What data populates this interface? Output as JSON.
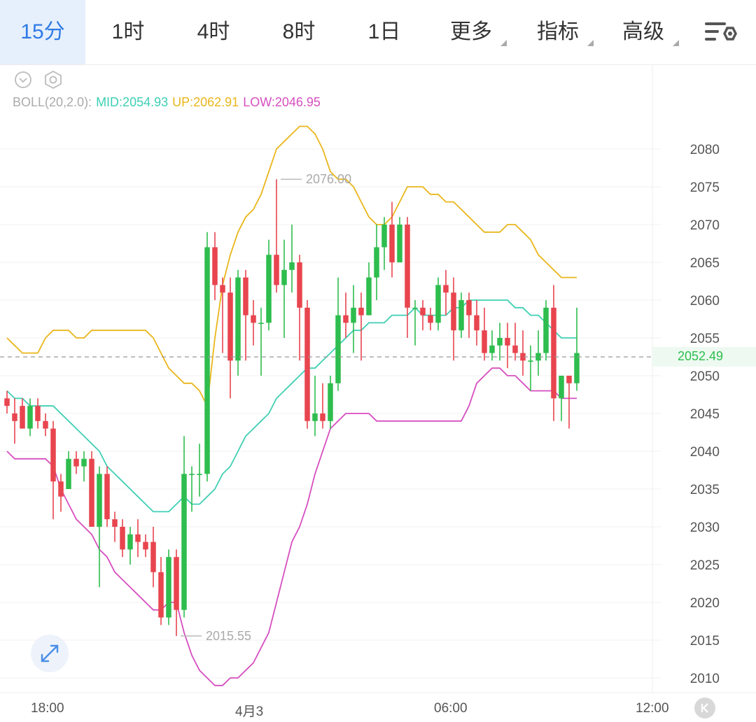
{
  "tabs": [
    {
      "label": "15分",
      "active": true
    },
    {
      "label": "1时"
    },
    {
      "label": "4时"
    },
    {
      "label": "8时"
    },
    {
      "label": "1日"
    },
    {
      "label": "更多",
      "dropdown": true
    },
    {
      "label": "指标",
      "dropdown": true
    },
    {
      "label": "高级",
      "dropdown": true
    }
  ],
  "icons": {
    "settings": "settings-sliders-icon",
    "collapse": "chevron-down-circle-icon",
    "gear": "hexagon-gear-icon",
    "expand": "expand-arrows-icon",
    "back": "skip-to-start-icon"
  },
  "indicator": {
    "name": "BOLL(20,2.0):",
    "mid": "MID:2054.93",
    "up": "UP:2062.91",
    "low": "LOW:2046.95"
  },
  "colors": {
    "up": "#e8454f",
    "down": "#2ebd4e",
    "mid": "#3fcfb4",
    "upper": "#e9b61b",
    "lower": "#d64fc0",
    "last_price": "#2ebd4e"
  },
  "xaxis": {
    "labels": [
      "18:00",
      "4月3",
      "06:00",
      "12:00"
    ]
  },
  "chart_data": {
    "type": "candlestick",
    "interval": "15分",
    "y_ticks": [
      2080,
      2075,
      2070,
      2065,
      2060,
      2055,
      2050,
      2045,
      2040,
      2035,
      2030,
      2025,
      2020,
      2015,
      2010
    ],
    "ylim": [
      2008,
      2084
    ],
    "last_price": 2052.49,
    "last_price_label": "2052.49",
    "high_marker": {
      "value": 2076.0,
      "label": "2076.00"
    },
    "low_marker": {
      "value": 2015.55,
      "label": "2015.55"
    },
    "candles": [
      [
        2047,
        2046,
        2048,
        2045
      ],
      [
        2045,
        2044,
        2047,
        2041
      ],
      [
        2046,
        2043,
        2047,
        2043
      ],
      [
        2043,
        2046,
        2047,
        2042
      ],
      [
        2046,
        2044,
        2047,
        2043
      ],
      [
        2044,
        2043,
        2045,
        2042
      ],
      [
        2043,
        2036,
        2044,
        2031
      ],
      [
        2036,
        2034,
        2037,
        2032
      ],
      [
        2035,
        2039,
        2040,
        2035
      ],
      [
        2039,
        2038,
        2040,
        2037
      ],
      [
        2038,
        2039,
        2040,
        2036
      ],
      [
        2039,
        2030,
        2040,
        2030
      ],
      [
        2030,
        2037,
        2038,
        2022
      ],
      [
        2037,
        2031,
        2038,
        2030
      ],
      [
        2031,
        2030,
        2032,
        2028
      ],
      [
        2030,
        2027,
        2031,
        2026
      ],
      [
        2027,
        2029,
        2030,
        2025
      ],
      [
        2029,
        2028,
        2031,
        2026
      ],
      [
        2028,
        2027,
        2029,
        2026
      ],
      [
        2028,
        2024,
        2030,
        2022
      ],
      [
        2024,
        2018,
        2026,
        2017
      ],
      [
        2018,
        2026,
        2027,
        2017
      ],
      [
        2026,
        2019,
        2027,
        2015.55
      ],
      [
        2019,
        2037,
        2042,
        2018
      ],
      [
        2037,
        2037,
        2038,
        2032
      ],
      [
        2037,
        2037,
        2041,
        2034
      ],
      [
        2037,
        2067,
        2069,
        2036
      ],
      [
        2067,
        2062,
        2069,
        2060
      ],
      [
        2062,
        2061,
        2063,
        2053
      ],
      [
        2061,
        2052,
        2063,
        2047
      ],
      [
        2052,
        2063,
        2064,
        2050
      ],
      [
        2063,
        2058,
        2064,
        2052
      ],
      [
        2058,
        2057,
        2060,
        2054
      ],
      [
        2057,
        2057,
        2059,
        2050
      ],
      [
        2057,
        2066,
        2068,
        2056
      ],
      [
        2066,
        2062,
        2076,
        2061
      ],
      [
        2062,
        2064,
        2068,
        2055
      ],
      [
        2064,
        2065,
        2070,
        2061
      ],
      [
        2065,
        2059,
        2066,
        2052
      ],
      [
        2059,
        2044,
        2060,
        2043
      ],
      [
        2044,
        2045,
        2050,
        2042
      ],
      [
        2045,
        2044,
        2049,
        2043
      ],
      [
        2044,
        2049,
        2050,
        2043
      ],
      [
        2049,
        2058,
        2063,
        2048
      ],
      [
        2058,
        2057,
        2061,
        2055
      ],
      [
        2057,
        2059,
        2062,
        2053
      ],
      [
        2059,
        2058,
        2061,
        2052
      ],
      [
        2058,
        2063,
        2065,
        2058
      ],
      [
        2063,
        2067,
        2070,
        2060
      ],
      [
        2067,
        2070,
        2071,
        2064
      ],
      [
        2070,
        2065,
        2073,
        2063
      ],
      [
        2065,
        2070,
        2071,
        2065
      ],
      [
        2070,
        2059,
        2071,
        2055
      ],
      [
        2059,
        2059,
        2060,
        2054
      ],
      [
        2059,
        2058,
        2060,
        2056
      ],
      [
        2058,
        2057,
        2059,
        2056
      ],
      [
        2057,
        2062,
        2063,
        2056
      ],
      [
        2062,
        2061,
        2064,
        2058
      ],
      [
        2061,
        2056,
        2063,
        2052
      ],
      [
        2056,
        2060,
        2061,
        2055
      ],
      [
        2060,
        2058,
        2061,
        2055
      ],
      [
        2058,
        2056,
        2060,
        2054
      ],
      [
        2056,
        2053,
        2059,
        2052
      ],
      [
        2053,
        2054,
        2056,
        2052
      ],
      [
        2054,
        2055,
        2057,
        2052
      ],
      [
        2055,
        2054,
        2057,
        2051
      ],
      [
        2054,
        2053,
        2057,
        2052
      ],
      [
        2053,
        2052,
        2056,
        2050
      ],
      [
        2052,
        2052,
        2054,
        2048
      ],
      [
        2052,
        2053,
        2056,
        2050
      ],
      [
        2053,
        2059,
        2060,
        2052
      ],
      [
        2059,
        2047,
        2062,
        2044
      ],
      [
        2047,
        2050,
        2050,
        2044
      ],
      [
        2050,
        2049,
        2050,
        2043
      ],
      [
        2049,
        2053,
        2059,
        2048
      ]
    ],
    "boll": {
      "up": [
        2055,
        2054,
        2053,
        2053,
        2053,
        2055,
        2056,
        2056,
        2056,
        2055,
        2055,
        2056,
        2056,
        2056,
        2056,
        2056,
        2056,
        2056,
        2056,
        2055,
        2053,
        2051,
        2050,
        2049,
        2049,
        2048,
        2046,
        2055,
        2062,
        2066,
        2069,
        2071,
        2072,
        2074,
        2077,
        2080,
        2081,
        2082,
        2083,
        2083,
        2082,
        2080,
        2077,
        2076,
        2076,
        2075,
        2073,
        2071,
        2070,
        2070,
        2071,
        2073,
        2075,
        2075,
        2075,
        2074,
        2074,
        2073,
        2073,
        2072,
        2071,
        2070,
        2069,
        2069,
        2069,
        2070,
        2070,
        2069,
        2068,
        2066,
        2065,
        2064,
        2063,
        2063,
        2063
      ],
      "mid": [
        2048,
        2047,
        2047,
        2046,
        2046,
        2046,
        2046,
        2045,
        2044,
        2043,
        2042,
        2041,
        2040,
        2038,
        2037,
        2036,
        2035,
        2034,
        2033,
        2032,
        2032,
        2032,
        2033,
        2034,
        2033,
        2033,
        2034,
        2035,
        2037,
        2038,
        2040,
        2042,
        2043,
        2044,
        2045,
        2047,
        2048,
        2049,
        2050,
        2051,
        2051,
        2052,
        2053,
        2054,
        2055,
        2056,
        2056,
        2057,
        2057,
        2057,
        2058,
        2058,
        2058,
        2059,
        2058,
        2058,
        2058,
        2058,
        2059,
        2059,
        2060,
        2060,
        2060,
        2060,
        2060,
        2060,
        2059,
        2059,
        2058,
        2058,
        2057,
        2056,
        2055,
        2055,
        2055
      ],
      "low": [
        2040,
        2039,
        2039,
        2039,
        2039,
        2039,
        2038,
        2035,
        2033,
        2031,
        2030,
        2029,
        2027,
        2026,
        2024,
        2023,
        2022,
        2021,
        2020,
        2019,
        2019,
        2020,
        2020,
        2016,
        2013,
        2011,
        2010,
        2009,
        2009,
        2010,
        2010,
        2011,
        2012,
        2014,
        2016,
        2020,
        2024,
        2028,
        2030,
        2033,
        2037,
        2040,
        2043,
        2044,
        2045,
        2045,
        2045,
        2045,
        2044,
        2044,
        2044,
        2044,
        2044,
        2044,
        2044,
        2044,
        2044,
        2044,
        2044,
        2044,
        2046,
        2049,
        2050,
        2051,
        2051,
        2050,
        2050,
        2049,
        2048,
        2048,
        2048,
        2048,
        2047,
        2047,
        2047
      ]
    }
  }
}
